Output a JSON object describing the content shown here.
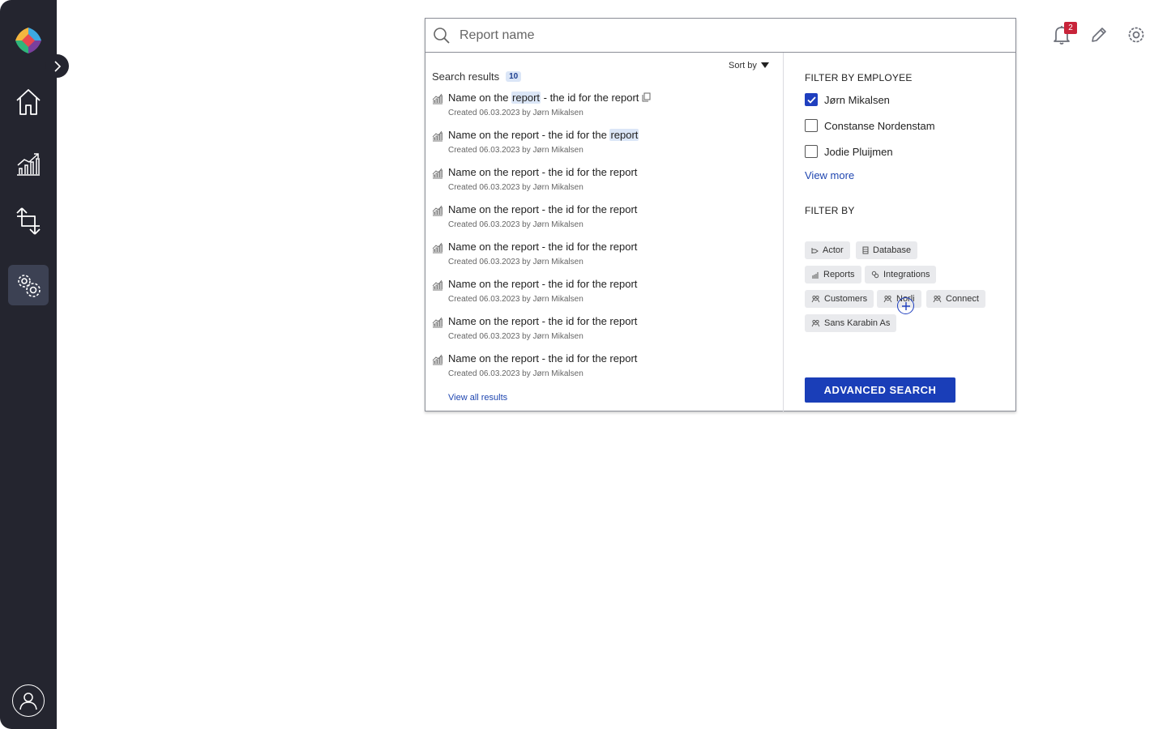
{
  "sidebar": {
    "logo": "app-logo",
    "collapse_icon": "chevron-right-icon",
    "nav": [
      {
        "name": "home",
        "icon": "home-icon",
        "active": false
      },
      {
        "name": "analytics",
        "icon": "chart-growth-icon",
        "active": false
      },
      {
        "name": "transfers",
        "icon": "transfer-arrows-icon",
        "active": false
      },
      {
        "name": "settings",
        "icon": "gears-icon",
        "active": true
      }
    ],
    "profile_icon": "user-icon"
  },
  "header": {
    "notifications_count": "2",
    "notification_icon": "bell-icon",
    "edit_icon": "pencil-icon",
    "settings_icon": "gear-icon"
  },
  "search": {
    "placeholder": "Report name",
    "value": "",
    "sort_label": "Sort by",
    "results_label": "Search results",
    "results_count": "10",
    "view_all_label": "View all results",
    "results": [
      {
        "pre": "Name on the ",
        "hl1": "report",
        "mid": " - the id for the report",
        "hl2": "",
        "meta": "Created 06.03.2023 by Jørn Mikalsen",
        "copy": true
      },
      {
        "pre": "Name on the report - the id for the ",
        "hl1": "",
        "mid": "",
        "hl2": "report",
        "meta": "Created 06.03.2023 by Jørn Mikalsen",
        "copy": false
      },
      {
        "pre": "Name on the report - the id for the report",
        "hl1": "",
        "mid": "",
        "hl2": "",
        "meta": "Created 06.03.2023 by Jørn Mikalsen",
        "copy": false
      },
      {
        "pre": "Name on the report - the id for the report",
        "hl1": "",
        "mid": "",
        "hl2": "",
        "meta": "Created 06.03.2023 by Jørn Mikalsen",
        "copy": false
      },
      {
        "pre": "Name on the report - the id for the report",
        "hl1": "",
        "mid": "",
        "hl2": "",
        "meta": "Created 06.03.2023 by Jørn Mikalsen",
        "copy": false
      },
      {
        "pre": "Name on the report - the id for the report",
        "hl1": "",
        "mid": "",
        "hl2": "",
        "meta": "Created 06.03.2023 by Jørn Mikalsen",
        "copy": false
      },
      {
        "pre": "Name on the report - the id for the report",
        "hl1": "",
        "mid": "",
        "hl2": "",
        "meta": "Created 06.03.2023 by Jørn Mikalsen",
        "copy": false
      },
      {
        "pre": "Name on the report - the id for the report",
        "hl1": "",
        "mid": "",
        "hl2": "",
        "meta": "Created 06.03.2023 by Jørn Mikalsen",
        "copy": false
      }
    ]
  },
  "filters": {
    "employee_heading": "FILTER BY EMPLOYEE",
    "employees": [
      {
        "name": "Jørn Mikalsen",
        "checked": true
      },
      {
        "name": "Constanse Nordenstam",
        "checked": false
      },
      {
        "name": "Jodie Pluijmen",
        "checked": false
      }
    ],
    "view_more_label": "View more",
    "filter_by_heading": "FILTER BY",
    "chips": [
      {
        "label": "Actor",
        "icon": "actor-icon"
      },
      {
        "label": "Database",
        "icon": "database-icon"
      },
      {
        "label": "Reports",
        "icon": "report-icon"
      },
      {
        "label": "Integrations",
        "icon": "integration-icon"
      },
      {
        "label": "Customers",
        "icon": "customers-icon"
      },
      {
        "label": "Norli",
        "icon": "customers-icon"
      },
      {
        "label": "Connect",
        "icon": "customers-icon"
      },
      {
        "label": "Sans Karabin As",
        "icon": "customers-icon"
      }
    ],
    "add_icon": "plus-circle-icon",
    "advanced_label": "ADVANCED SEARCH"
  },
  "colors": {
    "sidebar_bg": "#24252f",
    "accent": "#1a3eb8",
    "highlight": "#dbe6f7",
    "badge": "#c8243a"
  }
}
